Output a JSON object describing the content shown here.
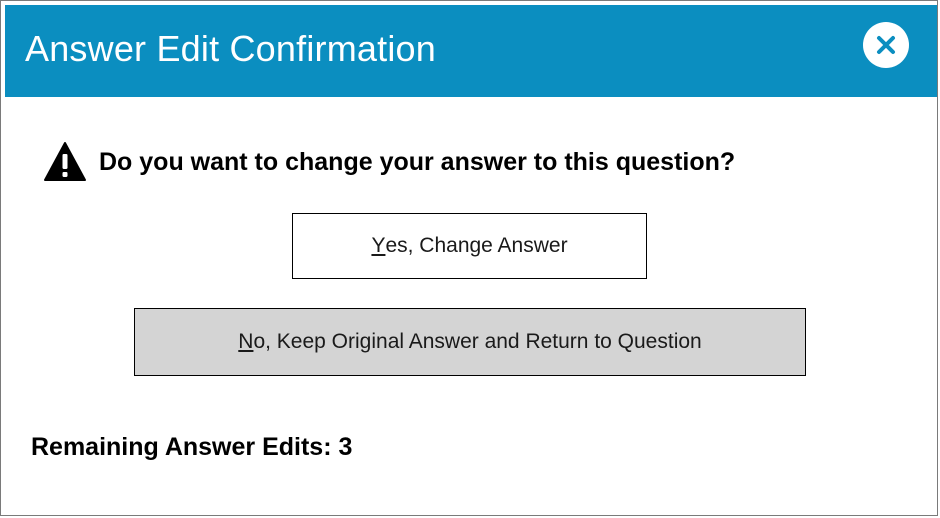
{
  "dialog": {
    "title": "Answer Edit Confirmation",
    "close_icon": "close-icon",
    "warning_icon": "warning-triangle-icon",
    "question": "Do you want to change your answer to this question?",
    "yes_button": {
      "access_key": "Y",
      "rest": "es, Change Answer"
    },
    "no_button": {
      "access_key": "N",
      "rest": "o, Keep Original Answer and Return to Question"
    },
    "remaining": {
      "label": "Remaining Answer Edits:",
      "count": "3"
    }
  },
  "colors": {
    "title_bar": "#0b8ec0",
    "title_text": "#ffffff",
    "no_button_bg": "#d4d4d4",
    "yes_button_bg": "#ffffff"
  }
}
